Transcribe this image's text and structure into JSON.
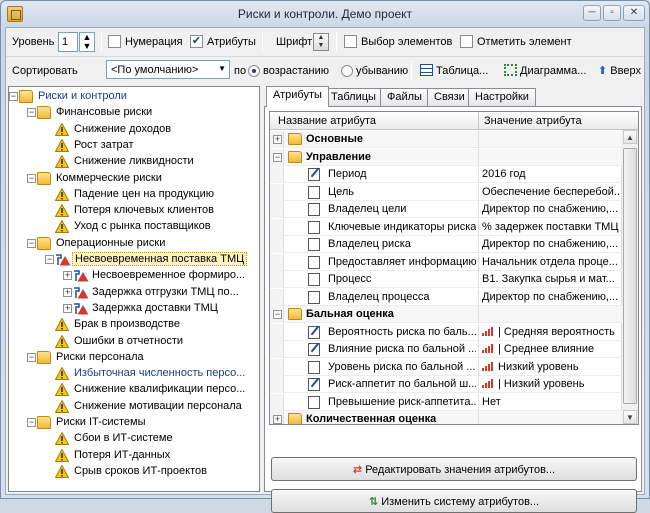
{
  "window": {
    "title": "Риски и контроли. Демо проект",
    "min": "─",
    "max": "▫",
    "close": "✕"
  },
  "toolbar1": {
    "level_label": "Уровень",
    "level_value": "1",
    "numbering_label": "Нумерация",
    "numbering_checked": false,
    "attributes_label": "Атрибуты",
    "attributes_checked": true,
    "font_label": "Шрифт",
    "select_elements_label": "Выбор элементов",
    "select_elements_checked": false,
    "mark_element_label": "Отметить элемент",
    "mark_element_checked": false
  },
  "toolbar2": {
    "sort_label": "Сортировать",
    "sort_value": "<По умолчанию>",
    "by_label": "по",
    "asc_label": "возрастанию",
    "desc_label": "убыванию",
    "table_button": "Таблица...",
    "diagram_button": "Диаграмма...",
    "up_button": "Вверх"
  },
  "tree": {
    "root": "Риски и контроли",
    "groups": [
      {
        "label": "Финансовые риски",
        "items": [
          "Снижение доходов",
          "Рост затрат",
          "Снижение ликвидности"
        ]
      },
      {
        "label": "Коммерческие риски",
        "items": [
          "Падение цен на продукцию",
          "Потеря ключевых клиентов",
          "Уход с рынка поставщиков"
        ]
      },
      {
        "label": "Операционные риски",
        "selected": "Несвоевременная поставка ТМЦ",
        "children": [
          "Несвоевременное формиро...",
          "Задержка отгрузки ТМЦ по...",
          "Задержка доставки ТМЦ"
        ],
        "items": [
          "Брак в производстве",
          "Ошибки в отчетности"
        ]
      },
      {
        "label": "Риски персонала",
        "items": [
          "Избыточная численность персо...",
          "Снижение квалификации персо...",
          "Снижение мотивации персонала"
        ]
      },
      {
        "label": "Риски IT-системы",
        "items": [
          "Сбои в ИТ-системе",
          "Потеря ИТ-данных",
          "Срыв сроков ИТ-проектов"
        ]
      }
    ]
  },
  "tabs": [
    "Атрибуты",
    "Таблицы",
    "Файлы",
    "Связи",
    "Настройки"
  ],
  "grid": {
    "col_name": "Название атрибута",
    "col_value": "Значение атрибута",
    "rows": [
      {
        "type": "cat",
        "expander": "+",
        "name": "Основные",
        "value": ""
      },
      {
        "type": "cat",
        "expander": "−",
        "name": "Управление",
        "value": ""
      },
      {
        "type": "row",
        "icon": "pen",
        "name": "Период",
        "value": "2016 год"
      },
      {
        "type": "row",
        "icon": "doc",
        "name": "Цель",
        "value": "Обеспечение бесперебой..."
      },
      {
        "type": "row",
        "icon": "doc",
        "name": "Владелец цели",
        "value": "Директор по снабжению,..."
      },
      {
        "type": "row",
        "icon": "doc",
        "name": "Ключевые индикаторы риска",
        "value": "% задержек поставки ТМЦ"
      },
      {
        "type": "row",
        "icon": "doc",
        "name": "Владелец риска",
        "value": "Директор по снабжению,..."
      },
      {
        "type": "row",
        "icon": "doc",
        "name": "Предоставляет информацию",
        "value": "Начальник отдела проце..."
      },
      {
        "type": "row",
        "icon": "doc",
        "name": "Процесс",
        "value": "В1. Закупка сырья и мат..."
      },
      {
        "type": "row",
        "icon": "doc",
        "name": "Владелец процесса",
        "value": "Директор по снабжению,..."
      },
      {
        "type": "cat",
        "expander": "−",
        "name": "Бальная оценка",
        "value": ""
      },
      {
        "type": "row",
        "icon": "pen",
        "name": "Вероятность риска по баль...",
        "value": "| Средняя вероятность",
        "bars": true
      },
      {
        "type": "row",
        "icon": "pen",
        "name": "Влияние риска по бальной ...",
        "value": "| Среднее влияние",
        "bars": true
      },
      {
        "type": "row",
        "icon": "doc",
        "name": "Уровень риска по бальной ...",
        "value": "Низкий уровень",
        "bars": true
      },
      {
        "type": "row",
        "icon": "pen",
        "name": "Риск-аппетит по бальной ш...",
        "value": "| Низкий уровень",
        "bars": true
      },
      {
        "type": "row",
        "icon": "doc",
        "name": "Превышение риск-аппетита...",
        "value": "Нет"
      },
      {
        "type": "cat",
        "expander": "+",
        "name": "Количественная оценка",
        "value": ""
      }
    ]
  },
  "buttons": {
    "edit_values": "Редактировать значения атрибутов...",
    "change_system": "Изменить систему атрибутов..."
  }
}
